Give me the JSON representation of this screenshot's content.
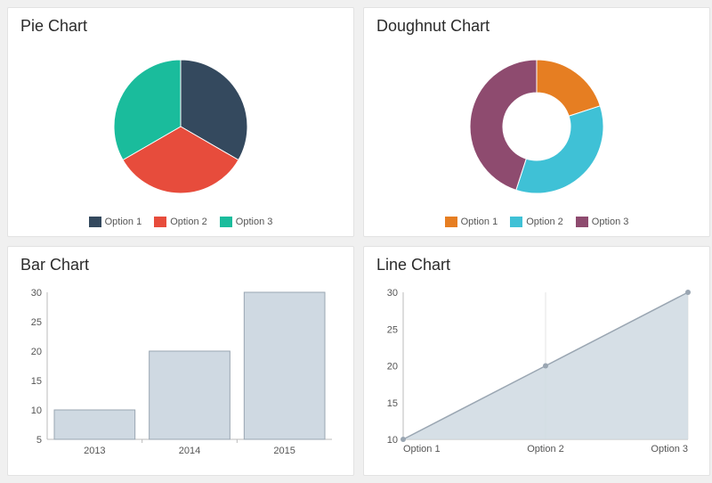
{
  "panels": {
    "pie": {
      "title": "Pie Chart"
    },
    "doughnut": {
      "title": "Doughnut Chart"
    },
    "bar": {
      "title": "Bar Chart"
    },
    "line": {
      "title": "Line Chart"
    }
  },
  "legends": {
    "pie": [
      {
        "label": "Option 1",
        "color": "#34495e"
      },
      {
        "label": "Option 2",
        "color": "#e74c3c"
      },
      {
        "label": "Option 3",
        "color": "#1abc9c"
      }
    ],
    "doughnut": [
      {
        "label": "Option 1",
        "color": "#e67e22"
      },
      {
        "label": "Option 2",
        "color": "#3fc1d6"
      },
      {
        "label": "Option 3",
        "color": "#8e4b6f"
      }
    ]
  },
  "chart_data": [
    {
      "type": "pie",
      "title": "Pie Chart",
      "series": [
        {
          "name": "Option 1",
          "value": 33.3,
          "color": "#34495e"
        },
        {
          "name": "Option 2",
          "value": 33.3,
          "color": "#e74c3c"
        },
        {
          "name": "Option 3",
          "value": 33.3,
          "color": "#1abc9c"
        }
      ]
    },
    {
      "type": "doughnut",
      "title": "Doughnut Chart",
      "series": [
        {
          "name": "Option 1",
          "value": 20,
          "color": "#e67e22"
        },
        {
          "name": "Option 2",
          "value": 35,
          "color": "#3fc1d6"
        },
        {
          "name": "Option 3",
          "value": 45,
          "color": "#8e4b6f"
        }
      ]
    },
    {
      "type": "bar",
      "title": "Bar Chart",
      "categories": [
        "2013",
        "2014",
        "2015"
      ],
      "values": [
        10,
        20,
        30
      ],
      "ylim": [
        5,
        30
      ],
      "yticks": [
        5,
        10,
        15,
        20,
        25,
        30
      ]
    },
    {
      "type": "area",
      "title": "Line Chart",
      "categories": [
        "Option 1",
        "Option 2",
        "Option 3"
      ],
      "values": [
        10,
        20,
        30
      ],
      "ylim": [
        10,
        30
      ],
      "yticks": [
        10,
        15,
        20,
        25,
        30
      ]
    }
  ]
}
